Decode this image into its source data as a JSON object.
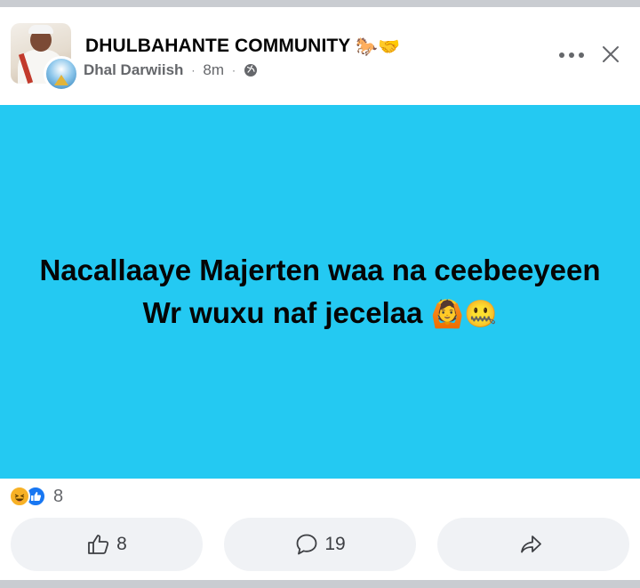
{
  "post": {
    "page_name": "DHULBAHANTE COMMUNITY",
    "title_emojis": "🐎🤝",
    "author": "Dhal Darwiish",
    "time": "8m",
    "separator": "·",
    "audience_icon": "globe-icon",
    "more_icon": "more-options-icon",
    "close_icon": "close-icon",
    "text_line_1": "Nacallaaye Majerten waa na ceebeeyeen",
    "text_line_2": "Wr wuxu naf jecelaa",
    "text_emojis": "🙆🤐",
    "background_color": "#24c9f2"
  },
  "reactions": {
    "icons": [
      "haha-reaction-icon",
      "like-reaction-icon"
    ],
    "count": "8"
  },
  "actions": {
    "like_count": "8",
    "comment_count": "19",
    "share_label": ""
  }
}
